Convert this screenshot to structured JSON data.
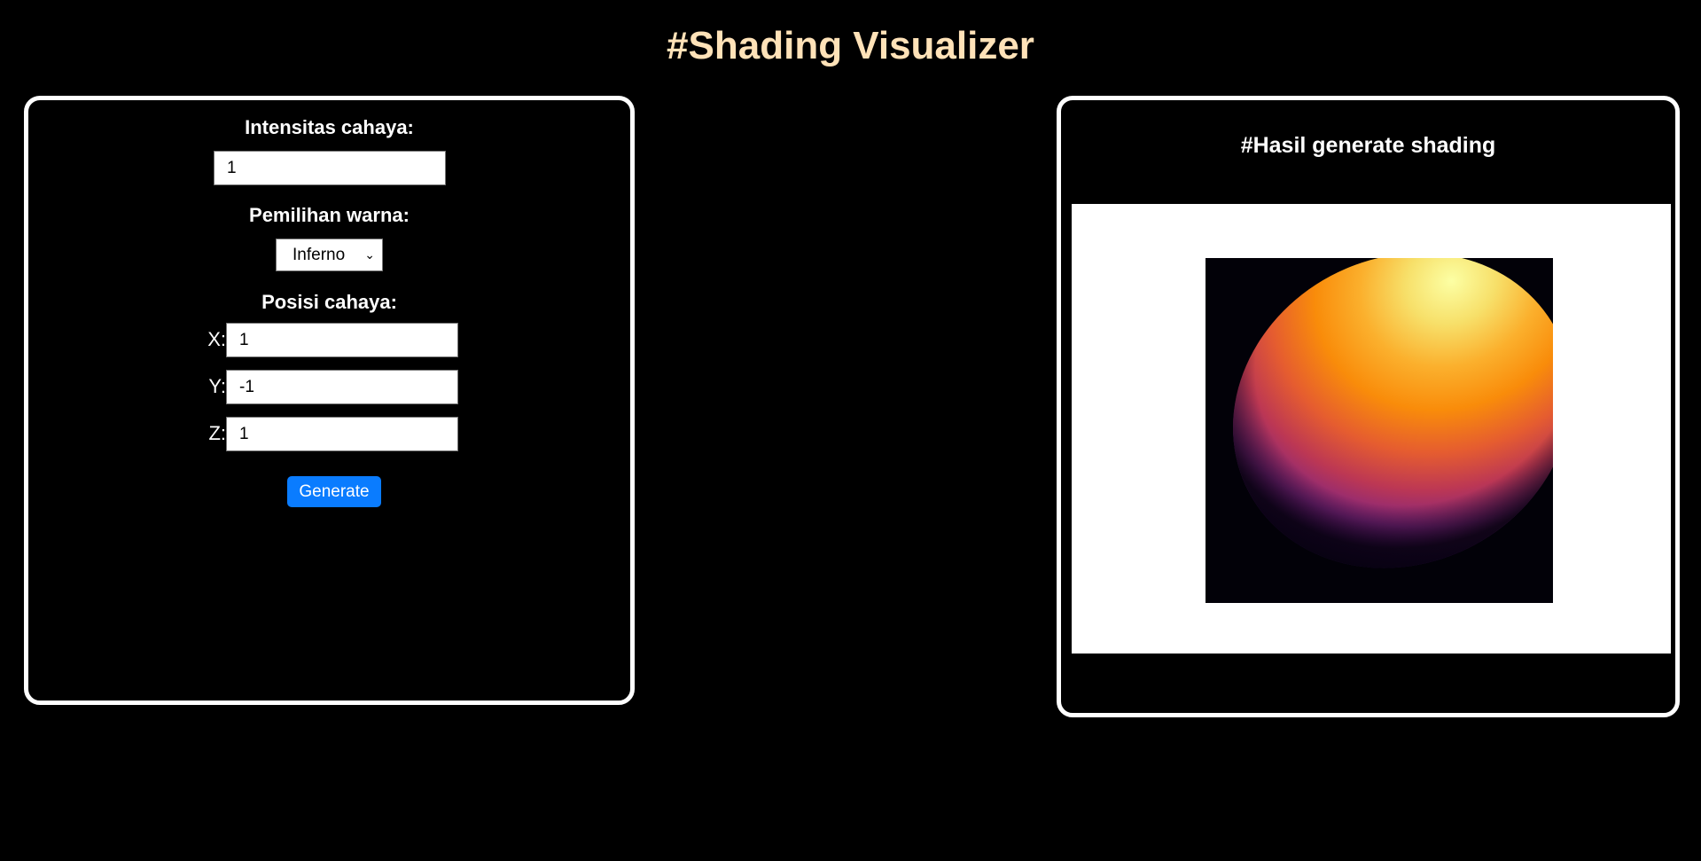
{
  "page": {
    "title": "#Shading Visualizer"
  },
  "controls": {
    "intensity_label": "Intensitas cahaya:",
    "intensity_value": "1",
    "color_label": "Pemilihan warna:",
    "color_selected": "Inferno",
    "position_label": "Posisi cahaya:",
    "x_label": "X:",
    "x_value": "1",
    "y_label": "Y:",
    "y_value": "-1",
    "z_label": "Z:",
    "z_value": "1",
    "generate_label": "Generate",
    "button_color": "#0a7cff"
  },
  "result": {
    "title": "#Hasil generate shading",
    "colormap": "inferno"
  }
}
